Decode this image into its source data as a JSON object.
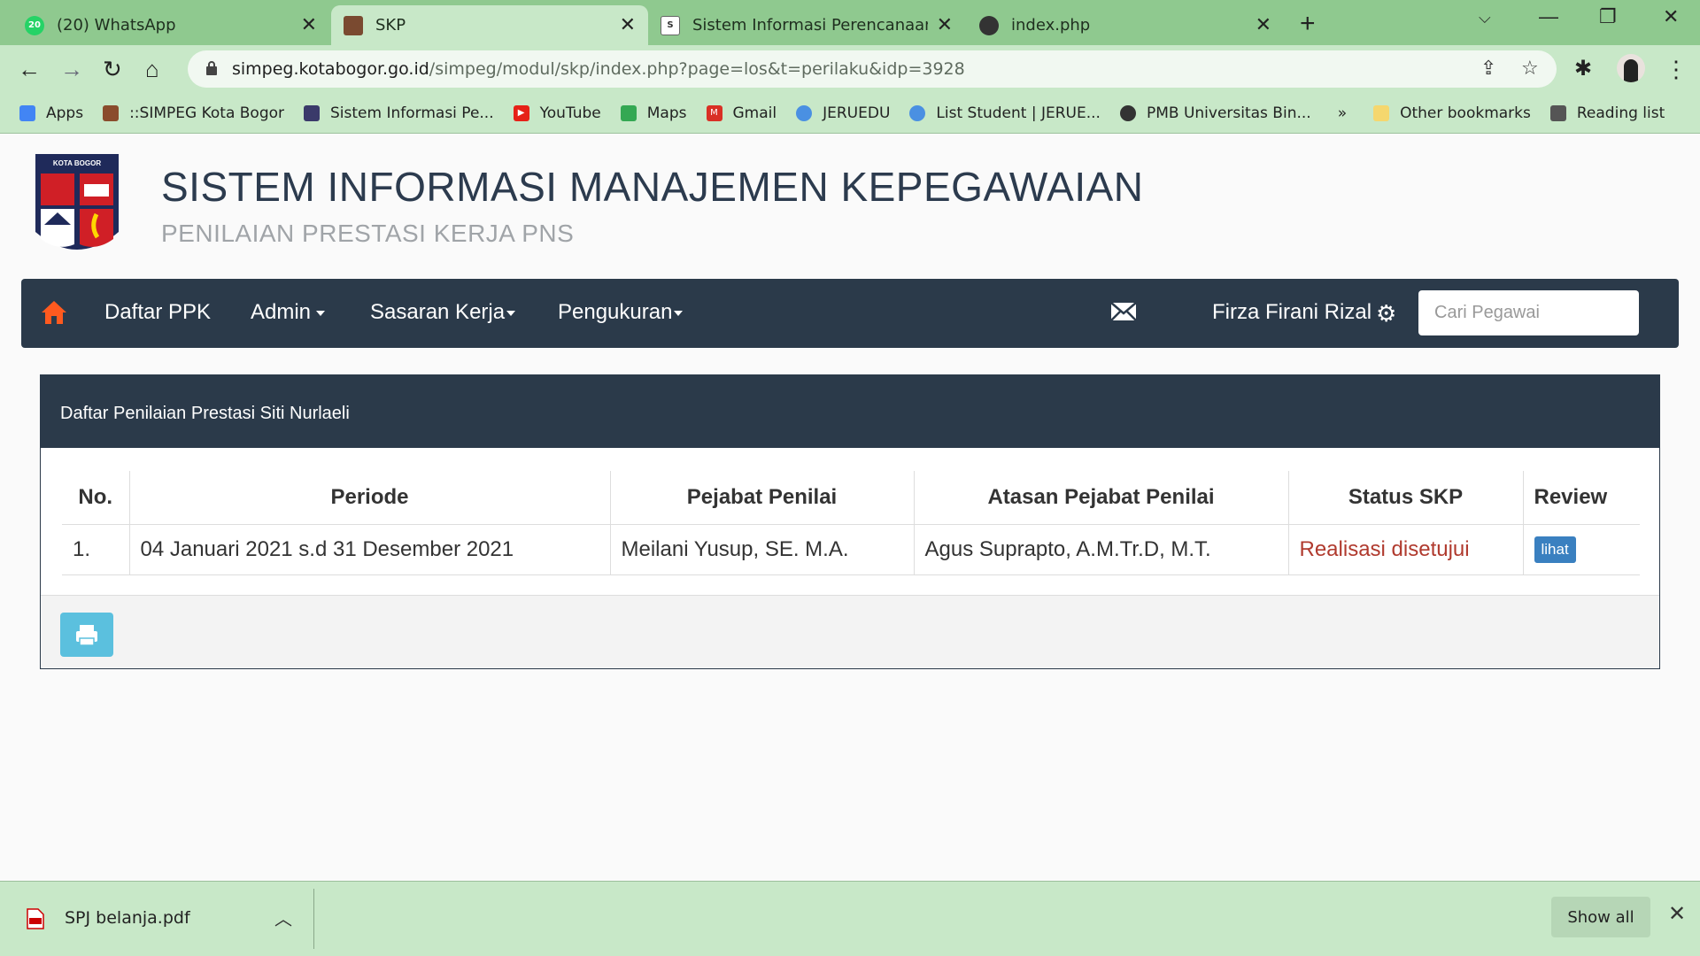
{
  "browser": {
    "tabs": [
      {
        "title": "(20) WhatsApp",
        "icon": "whatsapp-icon"
      },
      {
        "title": "SKP",
        "icon": "simpeg-icon"
      },
      {
        "title": "Sistem Informasi Perencanaan, M",
        "icon": "sipp-icon"
      },
      {
        "title": "index.php",
        "icon": "globe-icon"
      }
    ],
    "url_host": "simpeg.kotabogor.go.id",
    "url_path": "/simpeg/modul/skp/index.php?page=los&t=perilaku&idp=3928",
    "bookmarks": [
      {
        "label": "Apps",
        "icon": "apps-grid-icon",
        "color": "#4285f4"
      },
      {
        "label": "::SIMPEG Kota Bogor",
        "icon": "simpeg-icon",
        "color": "#8a4c2c"
      },
      {
        "label": "Sistem Informasi Pe...",
        "icon": "sipp-icon",
        "color": "#3a3a6a"
      },
      {
        "label": "YouTube",
        "icon": "youtube-icon",
        "color": "#e62117"
      },
      {
        "label": "Maps",
        "icon": "maps-icon",
        "color": "#34a853"
      },
      {
        "label": "Gmail",
        "icon": "gmail-icon",
        "color": "#d93025"
      },
      {
        "label": "JERUEDU",
        "icon": "jeruedu-icon",
        "color": "#4a90e2"
      },
      {
        "label": "List Student | JERUE...",
        "icon": "jeruedu-icon",
        "color": "#4a90e2"
      },
      {
        "label": "PMB Universitas Bin...",
        "icon": "globe-icon",
        "color": "#333333"
      }
    ],
    "bookmarks_more": "»",
    "other_bookmarks": "Other bookmarks",
    "reading_list": "Reading list"
  },
  "header": {
    "title": "SISTEM INFORMASI MANAJEMEN KEPEGAWAIAN",
    "subtitle": "PENILAIAN PRESTASI KERJA PNS",
    "logo_text": "KOTA BOGOR"
  },
  "navbar": {
    "items": [
      "Daftar PPK",
      "Admin",
      "Sasaran Kerja",
      "Pengukuran"
    ],
    "user": "Firza Firani Rizal",
    "search_placeholder": "Cari Pegawai"
  },
  "panel": {
    "title": "Daftar Penilaian Prestasi Siti Nurlaeli",
    "columns": [
      "No.",
      "Periode",
      "Pejabat Penilai",
      "Atasan Pejabat Penilai",
      "Status SKP",
      "Review"
    ],
    "rows": [
      {
        "no": "1.",
        "periode": "04 Januari 2021 s.d 31 Desember 2021",
        "pejabat": "Meilani Yusup, SE. M.A.",
        "atasan": "Agus Suprapto, A.M.Tr.D, M.T.",
        "status": "Realisasi disetujui",
        "review": "lihat"
      }
    ]
  },
  "download": {
    "file": "SPJ belanja.pdf",
    "show_all": "Show all"
  },
  "colors": {
    "navbar": "#2b3a4a",
    "home": "#ff5a1f",
    "status": "#b03a2e",
    "chrome": "#8fc98f"
  }
}
